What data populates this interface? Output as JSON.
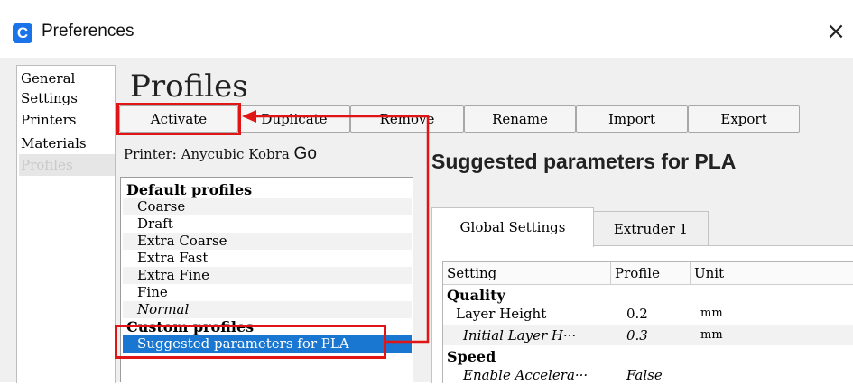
{
  "window": {
    "title": "Preferences",
    "close_glyph": "×",
    "app_icon": "cura-c-icon",
    "app_icon_letter": "C",
    "accent": "#1a73e8"
  },
  "sidebar": {
    "items": [
      {
        "label": "General",
        "selected": false
      },
      {
        "label": "Settings",
        "selected": false
      },
      {
        "label": "Printers",
        "selected": false
      },
      {
        "label": "Materials",
        "selected": false
      },
      {
        "label": "Profiles",
        "selected": true
      }
    ]
  },
  "main": {
    "heading": "Profiles",
    "toolbar": {
      "activate": "Activate",
      "duplicate": "Duplicate",
      "remove": "Remove",
      "rename": "Rename",
      "import": "Import",
      "export": "Export"
    },
    "printer_label": "Printer: Anycubic Kobra",
    "printer_suffix": "Go",
    "profiles": {
      "default_header": "Default profiles",
      "default_items": [
        "Coarse",
        "Draft",
        "Extra Coarse",
        "Extra Fast",
        "Extra Fine",
        "Fine",
        "Normal"
      ],
      "custom_header": "Custom profiles",
      "custom_items": [
        "Suggested parameters for PLA"
      ]
    },
    "selected_profile_title": "Suggested parameters for PLA",
    "tabs": [
      "Global Settings",
      "Extruder 1"
    ],
    "table": {
      "columns": [
        "Setting",
        "Profile",
        "Unit"
      ],
      "cat_quality": "Quality",
      "row_layer_height": {
        "setting": "Layer Height",
        "profile": "0.2",
        "unit": "mm"
      },
      "row_initial_layer": {
        "setting": "Initial Layer H···",
        "profile": "0.3",
        "unit": "mm"
      },
      "cat_speed": "Speed",
      "row_accel": {
        "setting": "Enable Accelera···",
        "profile": "False",
        "unit": ""
      }
    }
  },
  "annotations": {
    "highlight_color": "#e01515",
    "selection_color": "#1977d2"
  }
}
